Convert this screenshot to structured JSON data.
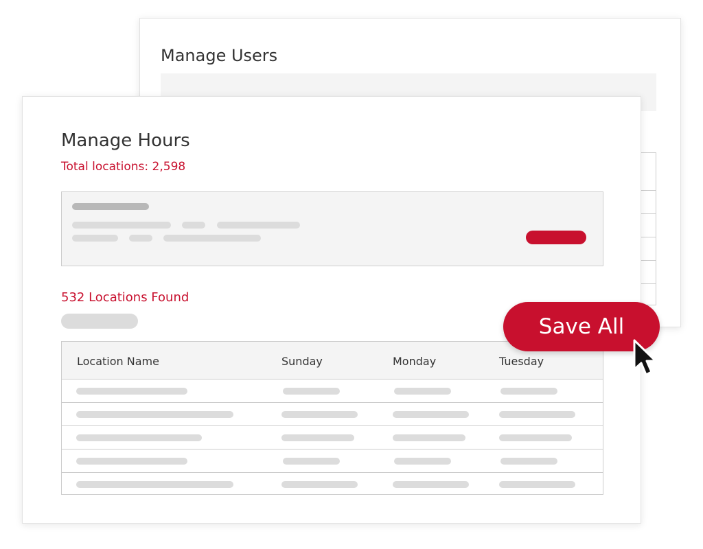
{
  "colors": {
    "accent": "#c8102e",
    "border": "#cccccc",
    "panel": "#f4f4f4",
    "placeholder": "#dcdcdc",
    "placeholder_dark": "#b8b8b8"
  },
  "back_panel": {
    "title": "Manage Users"
  },
  "front_panel": {
    "title": "Manage Hours",
    "total_locations": "Total locations: 2,598",
    "results_count": "532 Locations Found"
  },
  "table": {
    "columns": [
      "Location Name",
      "Sunday",
      "Monday",
      "Tuesday"
    ]
  },
  "save_button": {
    "label": "Save All"
  },
  "cursor": {
    "icon": "arrow-pointer-icon"
  }
}
